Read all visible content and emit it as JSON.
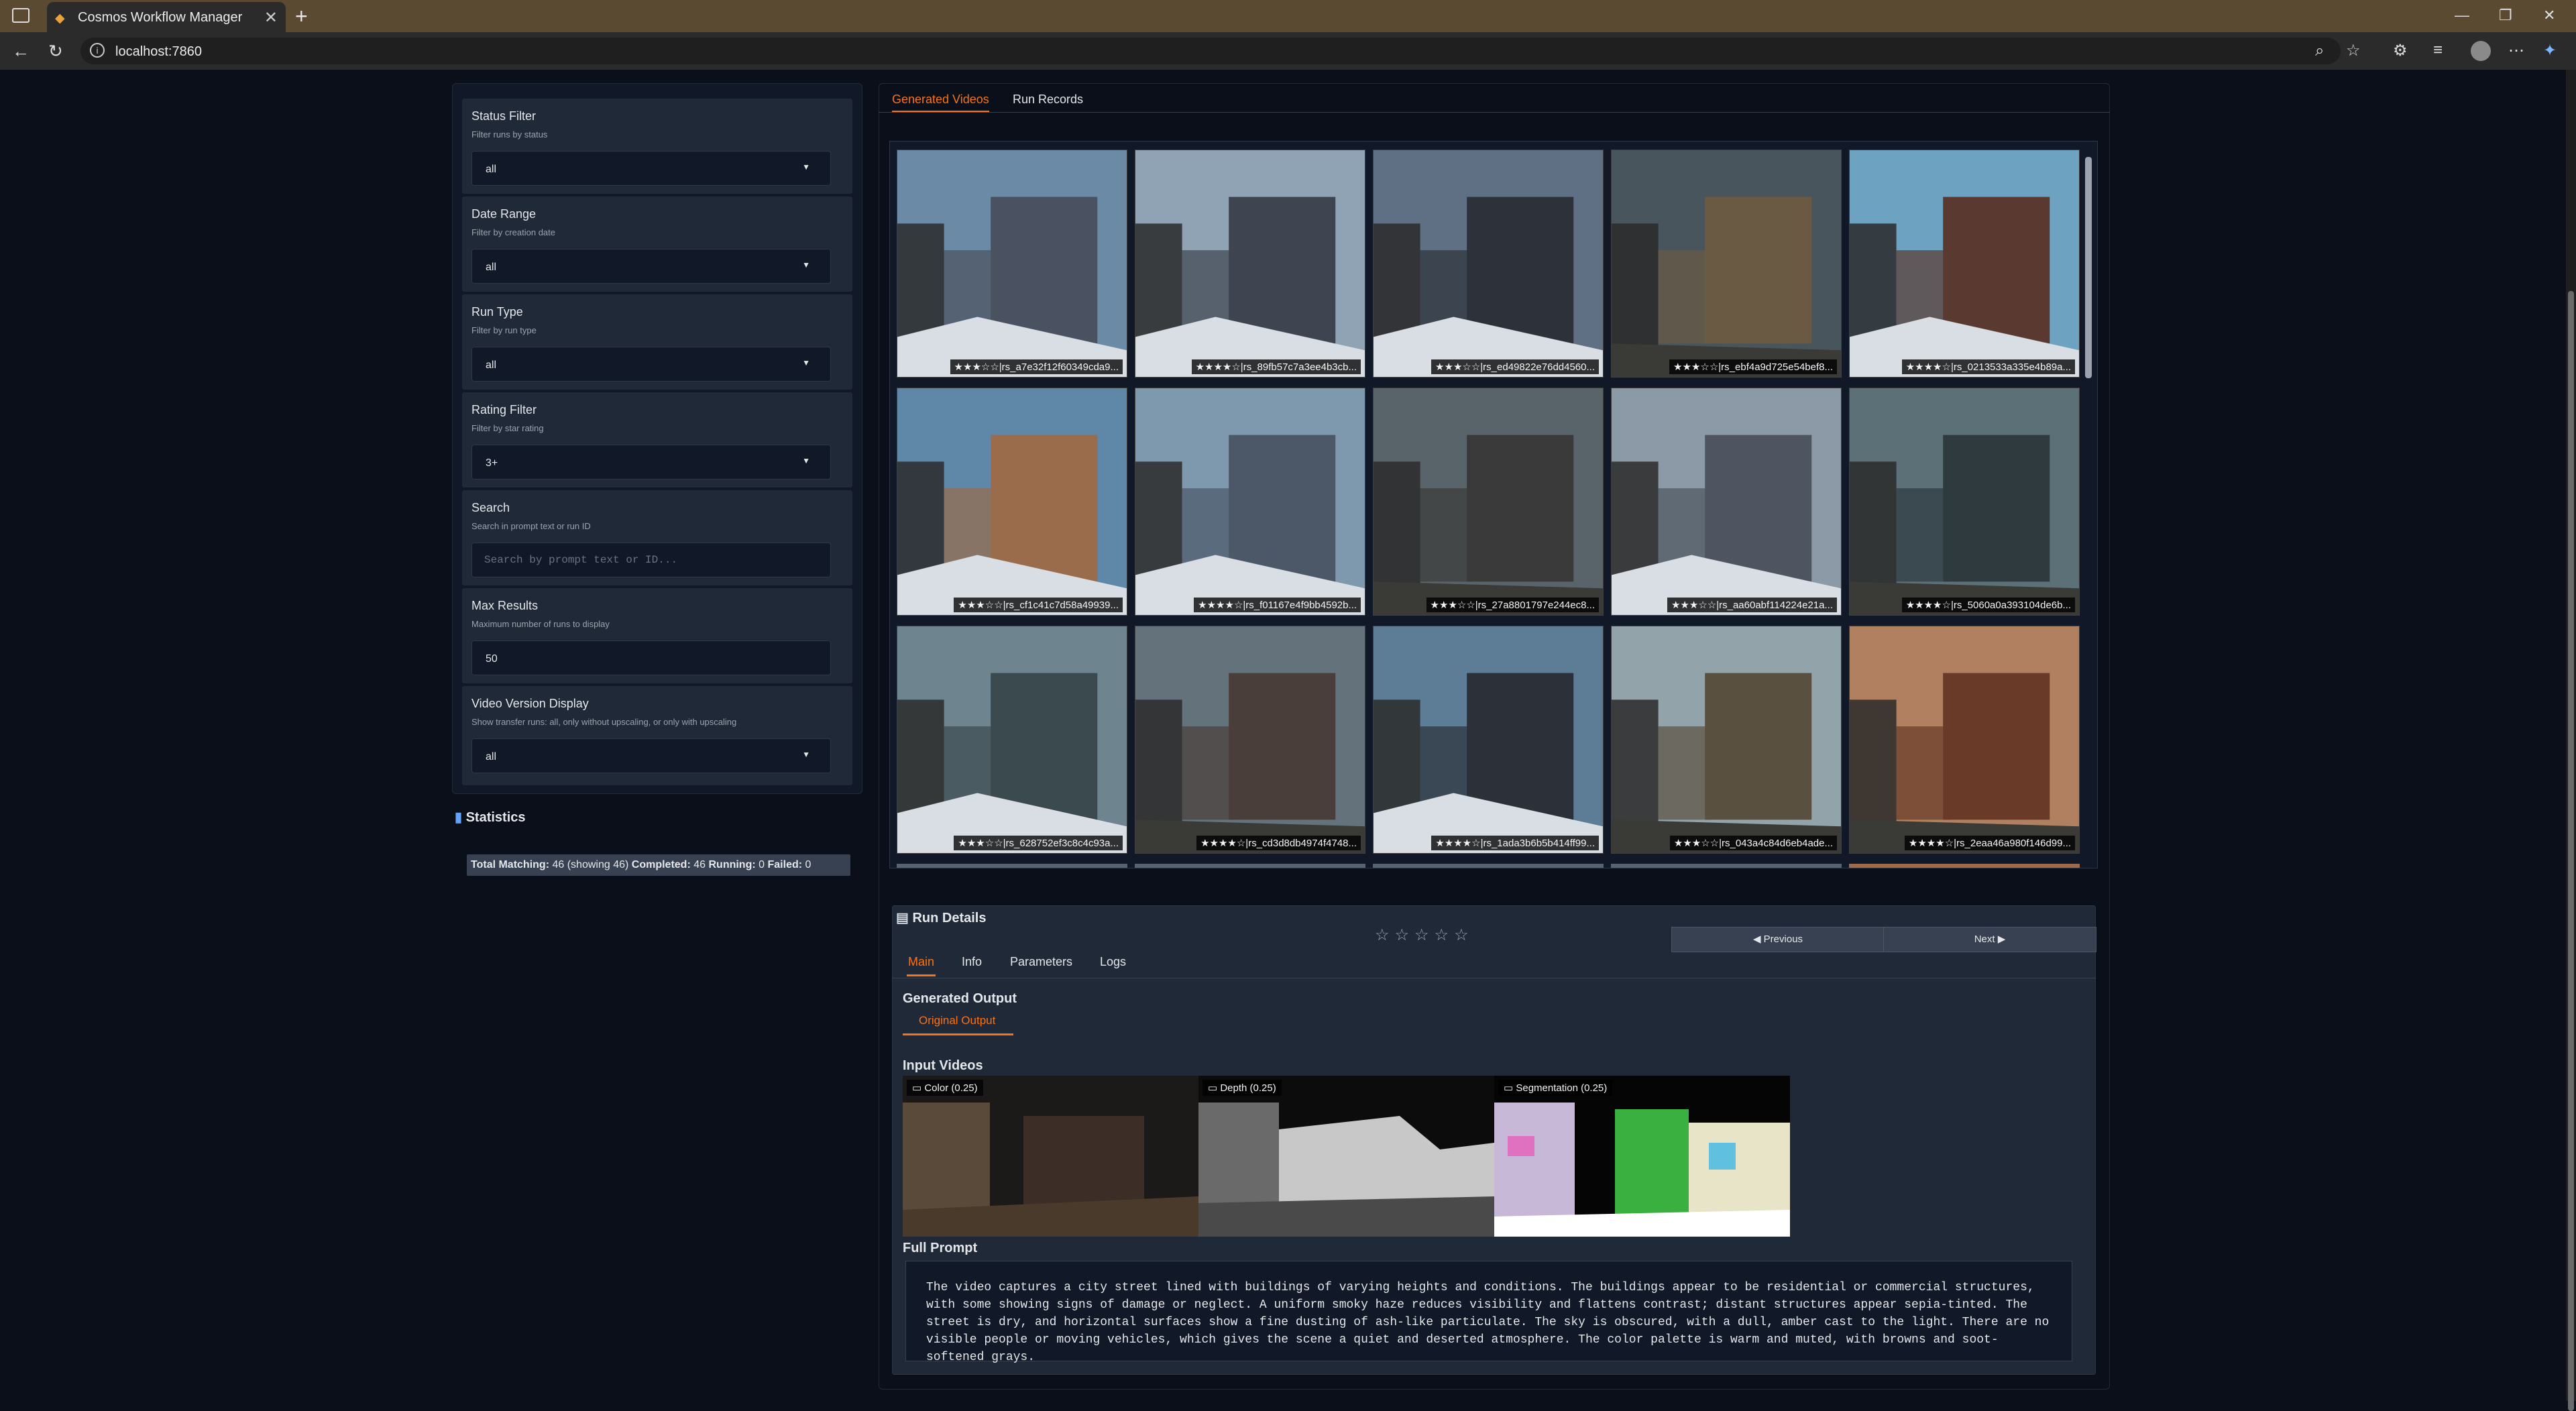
{
  "browser": {
    "tab_title": "Cosmos Workflow Manager",
    "url": "localhost:7860"
  },
  "filters": [
    {
      "label": "Status Filter",
      "info": "Filter runs by status",
      "value": "all",
      "type": "dropdown"
    },
    {
      "label": "Date Range",
      "info": "Filter by creation date",
      "value": "all",
      "type": "dropdown"
    },
    {
      "label": "Run Type",
      "info": "Filter by run type",
      "value": "all",
      "type": "dropdown"
    },
    {
      "label": "Rating Filter",
      "info": "Filter by star rating",
      "value": "3+",
      "type": "dropdown"
    },
    {
      "label": "Search",
      "info": "Search in prompt text or run ID",
      "placeholder": "Search by prompt text or ID...",
      "type": "text"
    },
    {
      "label": "Max Results",
      "info": "Maximum number of runs to display",
      "value": "50",
      "type": "number"
    },
    {
      "label": "Video Version Display",
      "info": "Show transfer runs: all, only without upscaling, or only with upscaling",
      "value": "all",
      "type": "dropdown"
    }
  ],
  "statistics": {
    "heading": "Statistics",
    "total_label": "Total Matching:",
    "total_value": "46 (showing 46)",
    "completed_label": "Completed:",
    "completed_value": "46",
    "running_label": "Running:",
    "running_value": "0",
    "failed_label": "Failed:",
    "failed_value": "0"
  },
  "main_tabs": {
    "active": "Generated Videos",
    "other": "Run Records"
  },
  "gallery": [
    {
      "caption": "★★★☆☆|rs_a7e32f12f60349cda9...",
      "sky": "#6b8aa6",
      "bldg": "#4a5160",
      "snow": true
    },
    {
      "caption": "★★★★☆|rs_89fb57c7a3ee4b3cb...",
      "sky": "#8fa3b5",
      "bldg": "#3e4550",
      "snow": true
    },
    {
      "caption": "★★★☆☆|rs_ed49822e76dd4560...",
      "sky": "#5f6f84",
      "bldg": "#2d323a",
      "snow": true
    },
    {
      "caption": "★★★☆☆|rs_ebf4a9d725e54bef8...",
      "sky": "#48555c",
      "bldg": "#6a5a44",
      "snow": false
    },
    {
      "caption": "★★★★☆|rs_0213533a335e4b89a...",
      "sky": "#6da2c0",
      "bldg": "#5a3a30",
      "snow": true
    },
    {
      "caption": "★★★☆☆|rs_cf1c41c7d58a49939...",
      "sky": "#5f88a8",
      "bldg": "#9a6c4c",
      "snow": true
    },
    {
      "caption": "★★★★☆|rs_f01167e4f9bb4592b...",
      "sky": "#7e98ad",
      "bldg": "#4c5868",
      "snow": true
    },
    {
      "caption": "★★★☆☆|rs_27a8801797e244ec8...",
      "sky": "#59646a",
      "bldg": "#3a3a3a",
      "snow": false
    },
    {
      "caption": "★★★☆☆|rs_aa60abf114224e21a...",
      "sky": "#8b9aa6",
      "bldg": "#4f5560",
      "snow": true
    },
    {
      "caption": "★★★★☆|rs_5060a0a393104de6b...",
      "sky": "#5c7078",
      "bldg": "#2e3a3e",
      "snow": false
    },
    {
      "caption": "★★★☆☆|rs_628752ef3c8c4c93a...",
      "sky": "#6e8590",
      "bldg": "#3b4a4e",
      "snow": true
    },
    {
      "caption": "★★★★☆|rs_cd3d8db4974f4748...",
      "sky": "#64727c",
      "bldg": "#4a3e3a",
      "snow": false
    },
    {
      "caption": "★★★★☆|rs_1ada3b6b5b414ff99...",
      "sky": "#5d7d96",
      "bldg": "#2c3038",
      "snow": true
    },
    {
      "caption": "★★★☆☆|rs_043a4c84d6eb4ade...",
      "sky": "#93a3aa",
      "bldg": "#5a5040",
      "snow": false
    },
    {
      "caption": "★★★★☆|rs_2eaa46a980f146d99...",
      "sky": "#b08060",
      "bldg": "#6a3a28",
      "snow": false
    }
  ],
  "run_details": {
    "heading": "Run Details",
    "stars": "☆☆☆☆☆",
    "prev": "◀ Previous",
    "next": "Next ▶",
    "tabs": [
      "Main",
      "Info",
      "Parameters",
      "Logs"
    ],
    "generated_output": "Generated Output",
    "original_output": "Original Output",
    "input_videos": "Input Videos",
    "videos": [
      {
        "label": "Color (0.25)",
        "kind": "color"
      },
      {
        "label": "Depth (0.25)",
        "kind": "depth"
      },
      {
        "label": "Segmentation (0.25)",
        "kind": "seg"
      }
    ],
    "full_prompt_label": "Full Prompt",
    "full_prompt": "The video captures a city street lined with buildings of varying heights and conditions. The buildings appear to be residential or commercial structures, with some showing signs of damage or neglect. A uniform smoky haze reduces visibility and flattens contrast; distant structures appear sepia-tinted. The street is dry, and horizontal surfaces show a fine dusting of ash-like particulate. The sky is obscured, with a dull, amber cast to the light. There are no visible people or moving vehicles, which gives the scene a quiet and deserted atmosphere. The color palette is warm and muted, with browns and soot-softened grays."
  },
  "colors": {
    "accent": "#f97316",
    "panel": "#1f2937",
    "bg": "#0b0f19"
  }
}
